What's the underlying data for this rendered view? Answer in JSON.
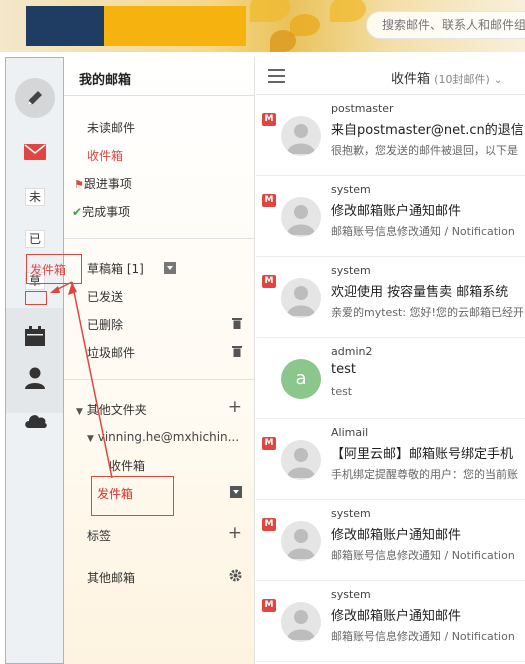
{
  "search": {
    "placeholder": "搜索邮件、联系人和邮件组"
  },
  "strip": {
    "unread_short": "未",
    "done_short": "已",
    "draft_short": "草"
  },
  "folders": {
    "title": "我的邮箱",
    "unread": "未读邮件",
    "inbox": "收件箱",
    "followup": "跟进事项",
    "done": "完成事项",
    "drafts": "草稿箱 [1]",
    "sent": "已发送",
    "deleted": "已删除",
    "junk": "垃圾邮件",
    "other_folders": "其他文件夹",
    "account": "vinning.he@mxhichin...",
    "sub_inbox": "收件箱",
    "sub_sent": "发件箱",
    "tags": "标签",
    "other_mailboxes": "其他邮箱"
  },
  "annotations": {
    "left_label": "发件箱",
    "right_label": "发件箱"
  },
  "list": {
    "box_title": "收件箱",
    "box_count": "(10封邮件)",
    "mails": [
      {
        "sender": "postmaster",
        "subject": "来自postmaster@net.cn的退信",
        "preview": "很抱歉，您发送的邮件被退回，以下是",
        "badge": "M"
      },
      {
        "sender": "system",
        "subject": "修改邮箱账户通知邮件",
        "preview": "邮箱账号信息修改通知 / Notification",
        "badge": "M"
      },
      {
        "sender": "system",
        "subject": "欢迎使用 按容量售卖 邮箱系统",
        "preview": "亲爱的mytest: 您好!您的云邮箱已经开",
        "badge": "M"
      },
      {
        "sender": "admin2",
        "subject": "test",
        "preview": "test",
        "avatar_letter": "a"
      },
      {
        "sender": "Alimail",
        "subject": "【阿里云邮】邮箱账号绑定手机",
        "preview": "手机绑定提醒尊敬的用户：您的当前账",
        "badge": "M"
      },
      {
        "sender": "system",
        "subject": "修改邮箱账户通知邮件",
        "preview": "邮箱账号信息修改通知 / Notification",
        "badge": "M"
      },
      {
        "sender": "system",
        "subject": "修改邮箱账户通知邮件",
        "preview": "邮箱账号信息修改通知 / Notification",
        "badge": "M"
      }
    ]
  }
}
